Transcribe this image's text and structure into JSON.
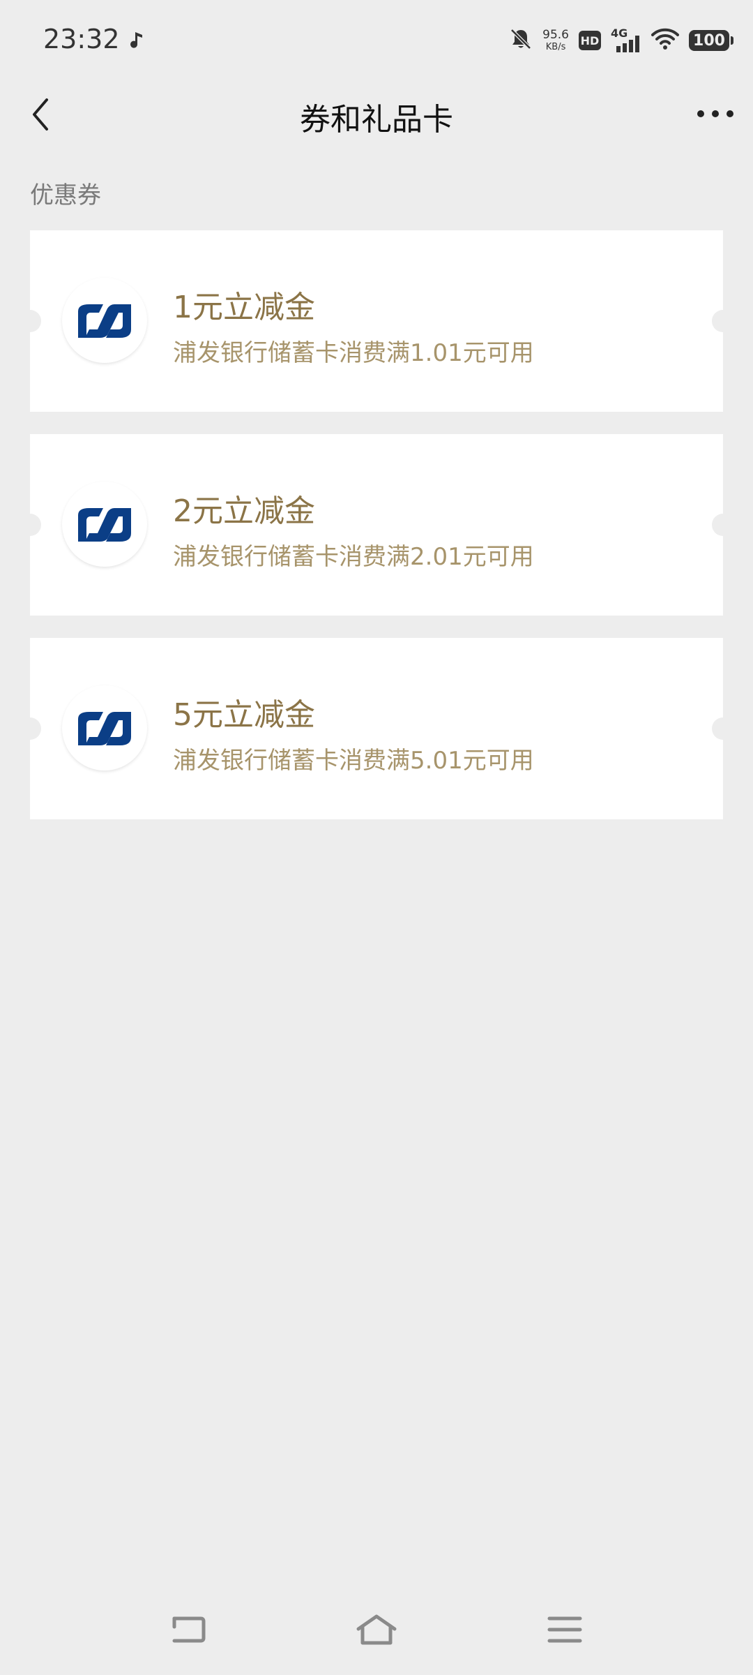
{
  "status_bar": {
    "time": "23:32",
    "net_speed_value": "95.6",
    "net_speed_unit": "KB/s",
    "hd_label": "HD",
    "network_label": "4G",
    "battery": "100"
  },
  "header": {
    "title": "券和礼品卡"
  },
  "section": {
    "label": "优惠券"
  },
  "coupons": [
    {
      "title": "1元立减金",
      "desc": "浦发银行储蓄卡消费满1.01元可用"
    },
    {
      "title": "2元立减金",
      "desc": "浦发银行储蓄卡消费满2.01元可用"
    },
    {
      "title": "5元立减金",
      "desc": "浦发银行储蓄卡消费满5.01元可用"
    }
  ],
  "colors": {
    "background": "#ededed",
    "card": "#ffffff",
    "coupon_title": "#8b7447",
    "coupon_desc": "#a7946b",
    "logo_blue": "#0b3e86"
  },
  "icons": {
    "status_left": "music-note-icon",
    "mute": "bell-off-icon",
    "wifi": "wifi-icon",
    "back": "chevron-left-icon",
    "more": "more-horizontal-icon",
    "coupon_logo": "spd-bank-logo-icon",
    "nav_back": "nav-back-icon",
    "nav_home": "nav-home-icon",
    "nav_menu": "nav-menu-icon"
  }
}
